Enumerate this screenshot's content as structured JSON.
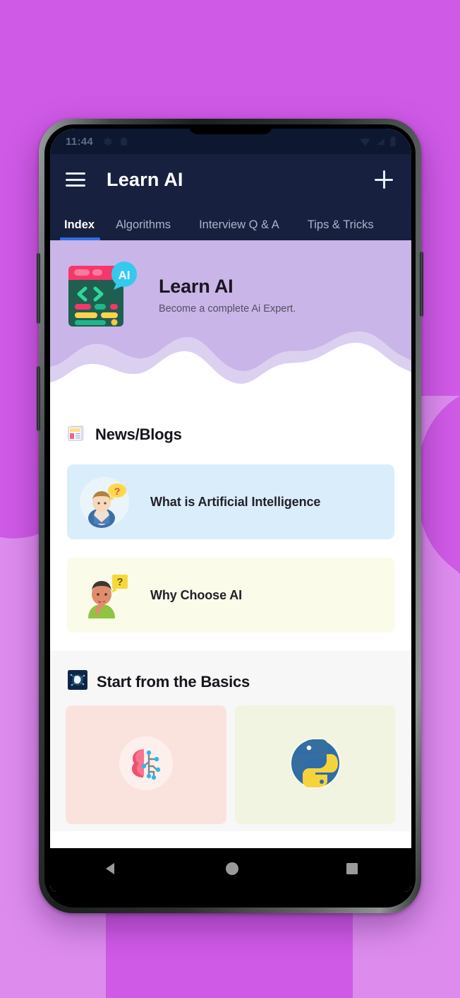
{
  "statusbar": {
    "time": "11:44",
    "left_icons": [
      "settings-gear-icon",
      "clipboard-icon"
    ],
    "right_icons": [
      "wifi-icon",
      "signal-icon",
      "battery-icon"
    ]
  },
  "appbar": {
    "menu_icon": "hamburger-menu-icon",
    "title": "Learn AI",
    "add_icon": "plus-icon",
    "background": "#17213f"
  },
  "tabs": {
    "items": [
      {
        "label": "Index",
        "active": true
      },
      {
        "label": "Algorithms",
        "active": false
      },
      {
        "label": "Interview Q & A",
        "active": false
      },
      {
        "label": "Tips & Tricks",
        "active": false
      }
    ],
    "indicator_color": "#2f6fe4"
  },
  "hero": {
    "icon": "code-window-ai-icon",
    "badge_text": "AI",
    "title": "Learn AI",
    "subtitle": "Become a complete Ai Expert.",
    "background": "#c9b5e8"
  },
  "news_section": {
    "icon": "newspaper-icon",
    "title": "News/Blogs",
    "cards": [
      {
        "label": "What is Artificial Intelligence",
        "icon": "person-question-bubble-icon",
        "background": "#daedfa"
      },
      {
        "label": "Why Choose AI",
        "icon": "person-thinking-question-icon",
        "background": "#fbfbea"
      }
    ]
  },
  "basics_section": {
    "icon": "ai-brain-chip-icon",
    "title": "Start from the Basics",
    "tiles": [
      {
        "icon": "brain-circuit-icon",
        "background": "#fbe3dd"
      },
      {
        "icon": "python-logo-icon",
        "background": "#f2f4e2"
      }
    ]
  },
  "navbar": {
    "buttons": [
      {
        "name": "back-button",
        "icon": "triangle-back-icon"
      },
      {
        "name": "home-button",
        "icon": "circle-home-icon"
      },
      {
        "name": "recents-button",
        "icon": "square-recents-icon"
      }
    ]
  },
  "backdrop": {
    "top_color": "#cf5ae6",
    "bottom_color": "#d98ae8"
  }
}
